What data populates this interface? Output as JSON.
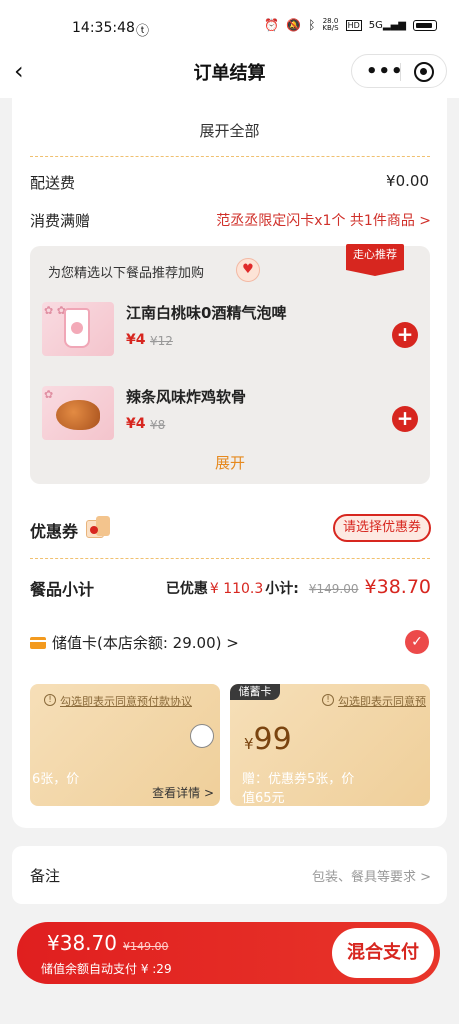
{
  "statusbar": {
    "time": "14:35:48",
    "speed_top": "28.0",
    "speed_unit": "KB/S",
    "hd": "HD",
    "network": "5G"
  },
  "navbar": {
    "title": "订单结算"
  },
  "order": {
    "expand_all": "展开全部",
    "delivery_label": "配送费",
    "delivery_value": "¥0.00",
    "gift_label": "消费满赠",
    "gift_value": "范丞丞限定闪卡x1个 共1件商品 >"
  },
  "recommend": {
    "title": "为您精选以下餐品推荐加购",
    "tag": "走心推荐",
    "items": [
      {
        "name": "江南白桃味0酒精气泡啤",
        "price": "¥4",
        "orig": "¥12"
      },
      {
        "name": "辣条风味炸鸡软骨",
        "price": "¥4",
        "orig": "¥8"
      }
    ],
    "more": "展开"
  },
  "coupon": {
    "label": "优惠券",
    "button": "请选择优惠券"
  },
  "subtotal": {
    "label": "餐品小计",
    "discount_label": "已优惠",
    "discount_value": "¥ 110.3",
    "total_label": "小计:",
    "orig": "¥149.00",
    "total": "¥38.70"
  },
  "stored_card": {
    "label": "储值卡(本店余额: 29.00) >"
  },
  "cards": [
    {
      "agree": "勾选即表示同意预付款协议",
      "gift": "6张，价",
      "detail": "查看详情 >"
    },
    {
      "badge": "储蓄卡",
      "agree": "勾选即表示同意预",
      "currency": "¥",
      "amount": "99",
      "gift": "赠：优惠券5张，价",
      "gift2": "值65元"
    }
  ],
  "note": {
    "label": "备注",
    "placeholder": "包装、餐具等要求 >"
  },
  "pay": {
    "amount": "¥38.70",
    "orig": "¥149.00",
    "sub": "储值余额自动支付 ¥ :29",
    "button": "混合支付"
  }
}
